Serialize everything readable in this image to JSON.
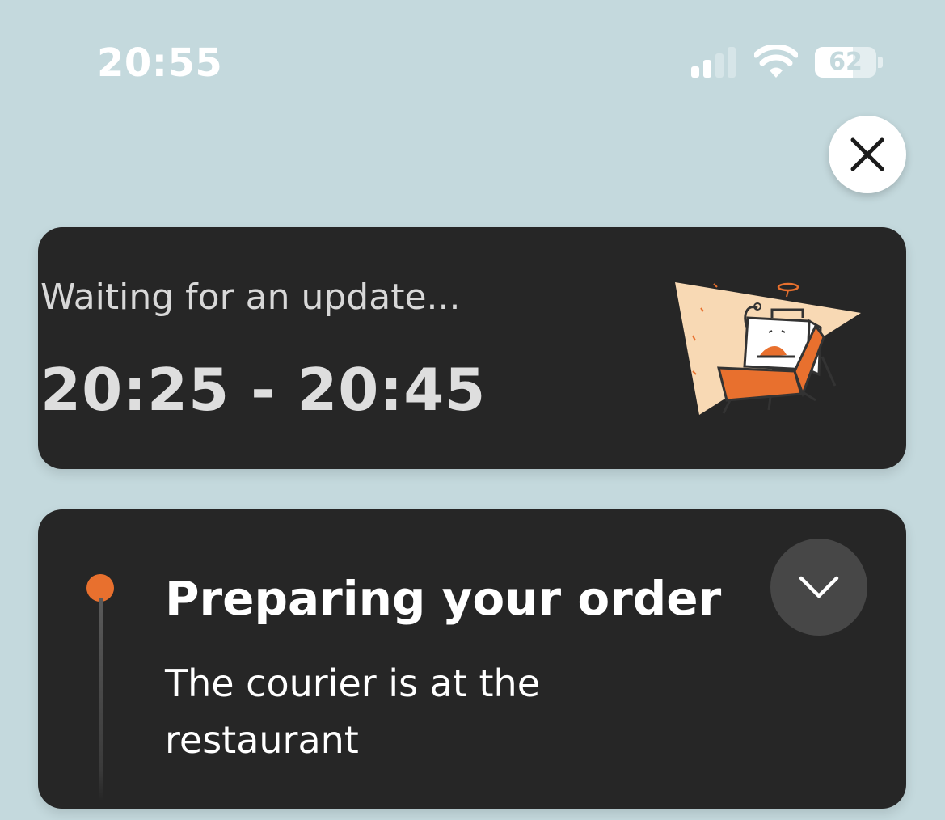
{
  "status_bar": {
    "time": "20:55",
    "battery_level": "62",
    "battery_fraction": 0.62,
    "signal_bars_active": 2,
    "signal_bars_total": 4,
    "icons": [
      "signal-icon",
      "wifi-icon",
      "battery-icon"
    ]
  },
  "close_button": {
    "icon": "close-icon"
  },
  "eta_card": {
    "label": "Waiting for an update...",
    "time_range": "20:25 - 20:45",
    "illustration": "delivery-box-illustration"
  },
  "status_card": {
    "title": "Preparing your order",
    "description": "The courier is at the restaurant",
    "expand_icon": "chevron-down-icon"
  },
  "colors": {
    "background": "#c4d9dd",
    "card": "#262626",
    "accent": "#e8702e",
    "expand_button": "#474747"
  }
}
